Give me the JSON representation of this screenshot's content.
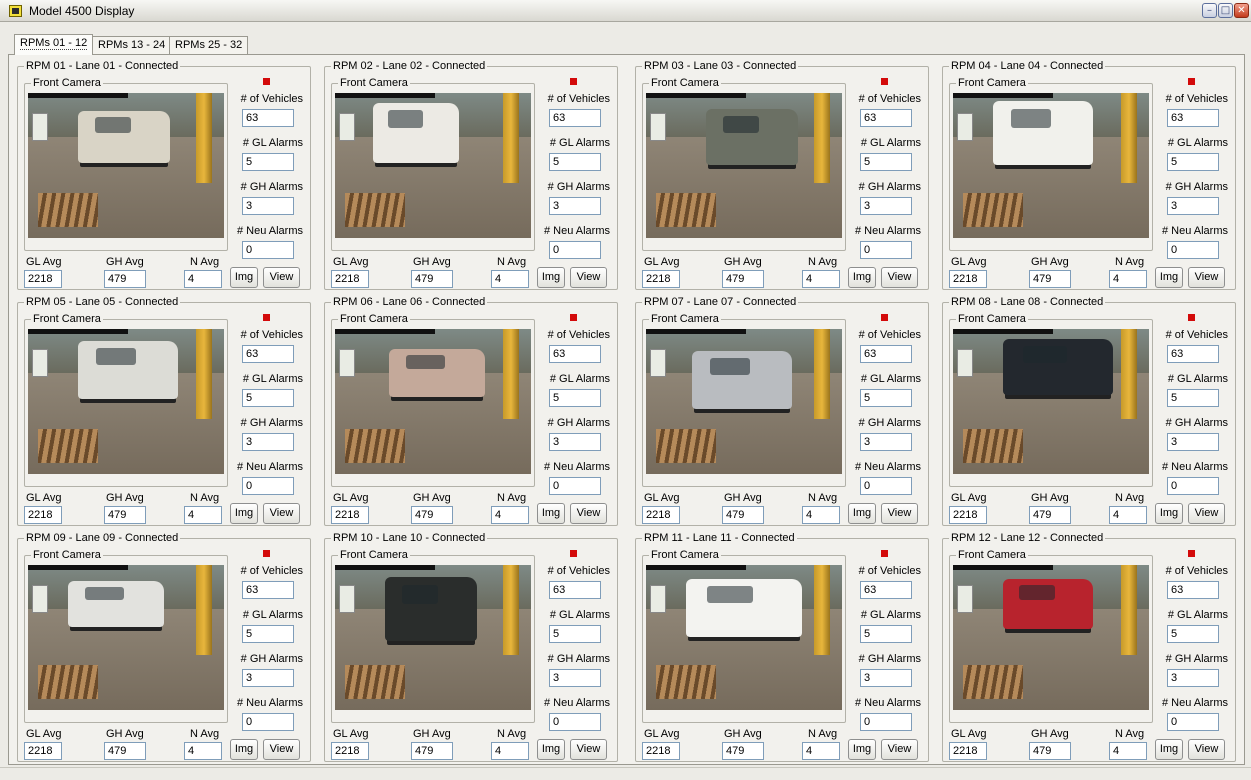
{
  "window": {
    "title": "Model 4500 Display",
    "controls": [
      "minimize",
      "maximize",
      "close"
    ]
  },
  "tabs": [
    {
      "label": "RPMs 01 - 12",
      "active": true
    },
    {
      "label": "RPMs 13 - 24",
      "active": false
    },
    {
      "label": "RPMs 25 - 32",
      "active": false
    }
  ],
  "labels": {
    "camera": "Front Camera",
    "vehicles": "# of Vehicles",
    "gl_alarms": "# GL Alarms",
    "gh_alarms": "# GH Alarms",
    "neu_alarms": "# Neu Alarms",
    "gl_avg": "GL Avg",
    "gh_avg": "GH Avg",
    "n_avg": "N Avg",
    "img_button": "Img",
    "view_button": "View"
  },
  "colors": {
    "status_indicator": "#d30a0a"
  },
  "panels": [
    {
      "title": "RPM 01 - Lane 01 - Connected",
      "vehicles": "63",
      "gl_alarms": "5",
      "gh_alarms": "3",
      "neu_alarms": "0",
      "gl_avg": "2218",
      "gh_avg": "479",
      "n_avg": "4",
      "vehicle_color": "#d9d4c6"
    },
    {
      "title": "RPM 02 - Lane 02 - Connected",
      "vehicles": "63",
      "gl_alarms": "5",
      "gh_alarms": "3",
      "neu_alarms": "0",
      "gl_avg": "2218",
      "gh_avg": "479",
      "n_avg": "4",
      "vehicle_color": "#eceae4"
    },
    {
      "title": "RPM 03 - Lane 03 - Connected",
      "vehicles": "63",
      "gl_alarms": "5",
      "gh_alarms": "3",
      "neu_alarms": "0",
      "gl_avg": "2218",
      "gh_avg": "479",
      "n_avg": "4",
      "vehicle_color": "#6b7064"
    },
    {
      "title": "RPM 04 - Lane 04 - Connected",
      "vehicles": "63",
      "gl_alarms": "5",
      "gh_alarms": "3",
      "neu_alarms": "0",
      "gl_avg": "2218",
      "gh_avg": "479",
      "n_avg": "4",
      "vehicle_color": "#f1f1ec"
    },
    {
      "title": "RPM 05 - Lane 05 - Connected",
      "vehicles": "63",
      "gl_alarms": "5",
      "gh_alarms": "3",
      "neu_alarms": "0",
      "gl_avg": "2218",
      "gh_avg": "479",
      "n_avg": "4",
      "vehicle_color": "#dcdcd6"
    },
    {
      "title": "RPM 06 - Lane 06 - Connected",
      "vehicles": "63",
      "gl_alarms": "5",
      "gh_alarms": "3",
      "neu_alarms": "0",
      "gl_avg": "2218",
      "gh_avg": "479",
      "n_avg": "4",
      "vehicle_color": "#c4a99a"
    },
    {
      "title": "RPM 07 - Lane 07 - Connected",
      "vehicles": "63",
      "gl_alarms": "5",
      "gh_alarms": "3",
      "neu_alarms": "0",
      "gl_avg": "2218",
      "gh_avg": "479",
      "n_avg": "4",
      "vehicle_color": "#b9bcc0"
    },
    {
      "title": "RPM 08 - Lane 08 - Connected",
      "vehicles": "63",
      "gl_alarms": "5",
      "gh_alarms": "3",
      "neu_alarms": "0",
      "gl_avg": "2218",
      "gh_avg": "479",
      "n_avg": "4",
      "vehicle_color": "#23282e"
    },
    {
      "title": "RPM 09 - Lane 09 - Connected",
      "vehicles": "63",
      "gl_alarms": "5",
      "gh_alarms": "3",
      "neu_alarms": "0",
      "gl_avg": "2218",
      "gh_avg": "479",
      "n_avg": "4",
      "vehicle_color": "#e2e2de"
    },
    {
      "title": "RPM 10 - Lane 10 - Connected",
      "vehicles": "63",
      "gl_alarms": "5",
      "gh_alarms": "3",
      "neu_alarms": "0",
      "gl_avg": "2218",
      "gh_avg": "479",
      "n_avg": "4",
      "vehicle_color": "#2a2d2c"
    },
    {
      "title": "RPM 11 - Lane 11 - Connected",
      "vehicles": "63",
      "gl_alarms": "5",
      "gh_alarms": "3",
      "neu_alarms": "0",
      "gl_avg": "2218",
      "gh_avg": "479",
      "n_avg": "4",
      "vehicle_color": "#f3f3f0"
    },
    {
      "title": "RPM 12 - Lane 12 - Connected",
      "vehicles": "63",
      "gl_alarms": "5",
      "gh_alarms": "3",
      "neu_alarms": "0",
      "gl_avg": "2218",
      "gh_avg": "479",
      "n_avg": "4",
      "vehicle_color": "#b8232d"
    }
  ]
}
